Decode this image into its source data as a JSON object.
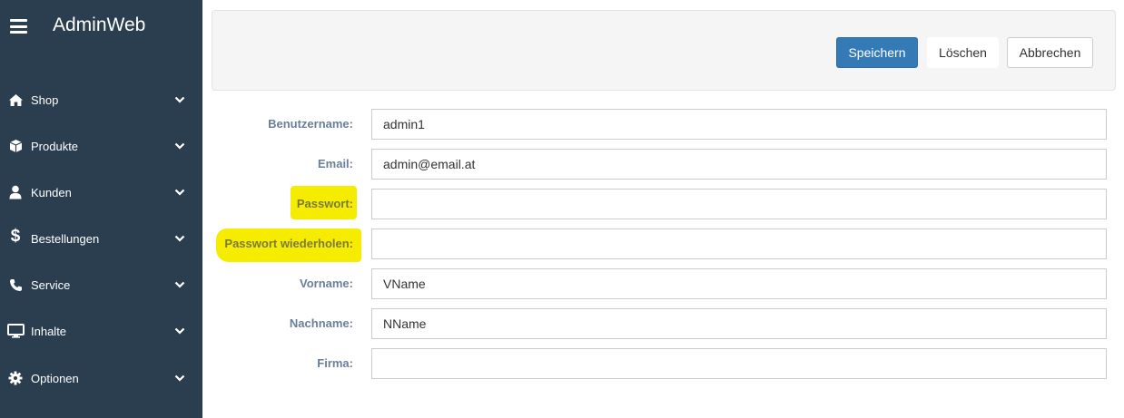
{
  "app": {
    "title": "AdminWeb"
  },
  "sidebar": {
    "items": [
      {
        "label": "Shop",
        "icon": "home-icon"
      },
      {
        "label": "Produkte",
        "icon": "cube-icon"
      },
      {
        "label": "Kunden",
        "icon": "user-icon"
      },
      {
        "label": "Bestellungen",
        "icon": "dollar-icon"
      },
      {
        "label": "Service",
        "icon": "phone-icon"
      },
      {
        "label": "Inhalte",
        "icon": "monitor-icon"
      },
      {
        "label": "Optionen",
        "icon": "gear-icon"
      }
    ]
  },
  "toolbar": {
    "save_label": "Speichern",
    "delete_label": "Löschen",
    "cancel_label": "Abbrechen"
  },
  "form": {
    "username": {
      "label": "Benutzername:",
      "value": "admin1"
    },
    "email": {
      "label": "Email:",
      "value": "admin@email.at"
    },
    "password": {
      "label": "Passwort:",
      "value": ""
    },
    "password_repeat": {
      "label": "Passwort wiederholen:",
      "value": ""
    },
    "firstname": {
      "label": "Vorname:",
      "value": "VName"
    },
    "lastname": {
      "label": "Nachname:",
      "value": "NName"
    },
    "company": {
      "label": "Firma:",
      "value": ""
    }
  },
  "colors": {
    "sidebar_bg": "#2b3e50",
    "primary": "#337ab7",
    "label": "#6b7f99",
    "highlight": "#f6ec00"
  }
}
